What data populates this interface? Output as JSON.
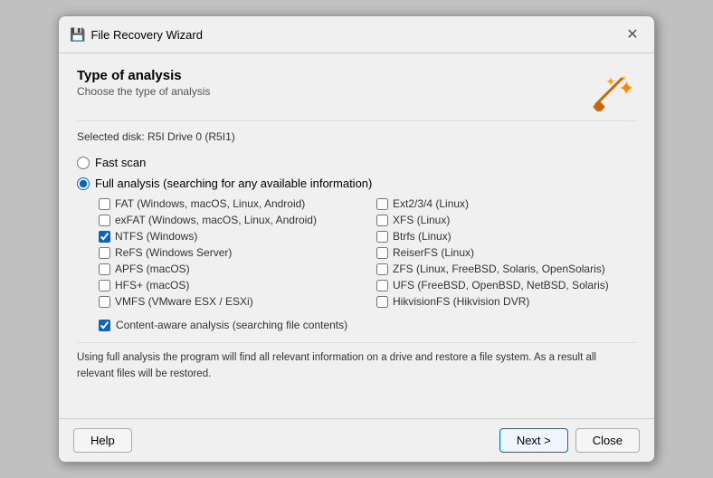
{
  "titleBar": {
    "icon": "💾",
    "title": "File Recovery Wizard",
    "closeLabel": "✕"
  },
  "header": {
    "title": "Type of analysis",
    "subtitle": "Choose the type of analysis"
  },
  "selectedDisk": {
    "label": "Selected disk: R5I Drive 0 (R5I1)"
  },
  "options": {
    "fastScan": {
      "label": "Fast scan",
      "checked": false
    },
    "fullAnalysis": {
      "label": "Full analysis (searching for any available information)",
      "checked": true
    }
  },
  "filesystems": {
    "left": [
      {
        "id": "fat",
        "label": "FAT (Windows, macOS, Linux, Android)",
        "checked": false
      },
      {
        "id": "exfat",
        "label": "exFAT (Windows, macOS, Linux, Android)",
        "checked": false
      },
      {
        "id": "ntfs",
        "label": "NTFS (Windows)",
        "checked": true
      },
      {
        "id": "refs",
        "label": "ReFS (Windows Server)",
        "checked": false
      },
      {
        "id": "apfs",
        "label": "APFS (macOS)",
        "checked": false
      },
      {
        "id": "hfsplus",
        "label": "HFS+ (macOS)",
        "checked": false
      },
      {
        "id": "vmfs",
        "label": "VMFS (VMware ESX / ESXi)",
        "checked": false
      }
    ],
    "right": [
      {
        "id": "ext234",
        "label": "Ext2/3/4 (Linux)",
        "checked": false
      },
      {
        "id": "xfs",
        "label": "XFS (Linux)",
        "checked": false
      },
      {
        "id": "btrfs",
        "label": "Btrfs (Linux)",
        "checked": false
      },
      {
        "id": "reiserfs",
        "label": "ReiserFS (Linux)",
        "checked": false
      },
      {
        "id": "zfs",
        "label": "ZFS (Linux, FreeBSD, Solaris, OpenSolaris)",
        "checked": false
      },
      {
        "id": "ufs",
        "label": "UFS (FreeBSD, OpenBSD, NetBSD, Solaris)",
        "checked": false
      },
      {
        "id": "hikvision",
        "label": "HikvisionFS (Hikvision DVR)",
        "checked": false
      }
    ]
  },
  "contentAware": {
    "label": "Content-aware analysis (searching file contents)",
    "checked": true
  },
  "description": "Using full analysis the program will find all relevant information on a drive and restore a file system. As a result all relevant files will be restored.",
  "footer": {
    "helpLabel": "Help",
    "nextLabel": "Next >",
    "closeLabel": "Close"
  }
}
